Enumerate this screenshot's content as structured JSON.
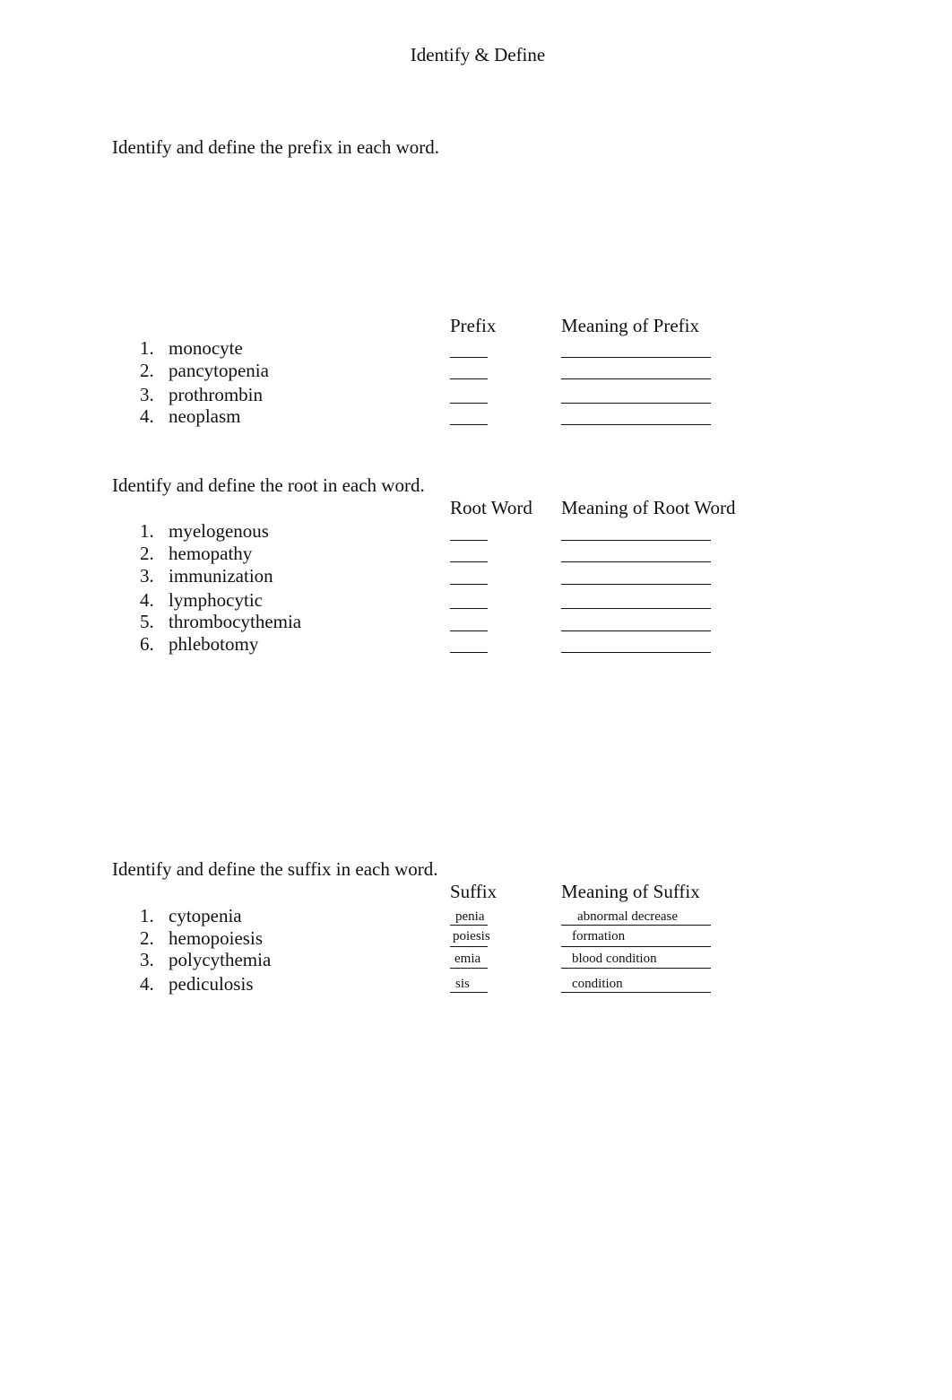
{
  "title": "Identify & Define",
  "sections": {
    "prefix": {
      "instruction": "Identify and define the prefix in each word.",
      "col1": "Prefix",
      "col2": "Meaning of Prefix",
      "items": [
        {
          "num": "1.",
          "word": "monocyte",
          "answer": "",
          "meaning": ""
        },
        {
          "num": "2.",
          "word": "pancytopenia",
          "answer": "",
          "meaning": ""
        },
        {
          "num": "3.",
          "word": "prothrombin",
          "answer": "",
          "meaning": ""
        },
        {
          "num": "4.",
          "word": "neoplasm",
          "answer": "",
          "meaning": ""
        }
      ]
    },
    "root": {
      "instruction": "Identify and define the root in each word.",
      "col1": "Root Word",
      "col2": "Meaning of Root Word",
      "items": [
        {
          "num": "1.",
          "word": "myelogenous",
          "answer": "",
          "meaning": ""
        },
        {
          "num": "2.",
          "word": "hemopathy",
          "answer": "",
          "meaning": ""
        },
        {
          "num": "3.",
          "word": "immunization",
          "answer": "",
          "meaning": ""
        },
        {
          "num": "4.",
          "word": "lymphocytic",
          "answer": "",
          "meaning": ""
        },
        {
          "num": "5.",
          "word": "thrombocythemia",
          "answer": "",
          "meaning": ""
        },
        {
          "num": "6.",
          "word": "phlebotomy",
          "answer": "",
          "meaning": ""
        }
      ]
    },
    "suffix": {
      "instruction": "Identify and define the suffix in each word.",
      "col1": "Suffix",
      "col2": "Meaning of Suffix",
      "items": [
        {
          "num": "1.",
          "word": "cytopenia",
          "answer": "penia",
          "meaning": "abnormal decrease"
        },
        {
          "num": "2.",
          "word": "hemopoiesis",
          "answer": "poiesis",
          "meaning": "formation"
        },
        {
          "num": "3.",
          "word": "polycythemia",
          "answer": "emia",
          "meaning": "blood condition"
        },
        {
          "num": "4.",
          "word": "pediculosis",
          "answer": "sis",
          "meaning": "condition"
        }
      ]
    }
  }
}
